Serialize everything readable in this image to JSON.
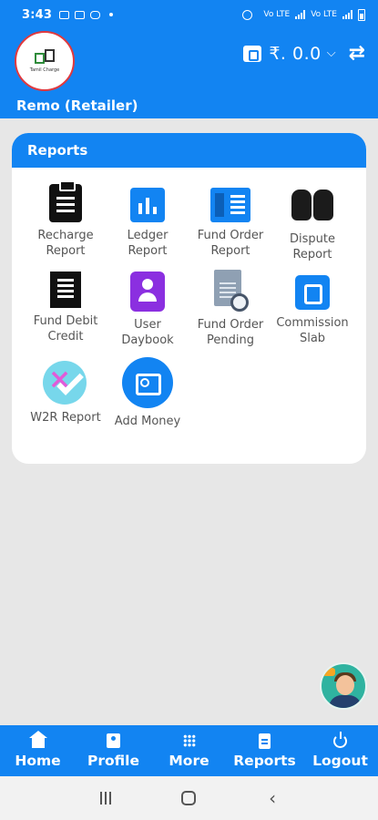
{
  "status_bar": {
    "time": "3:43",
    "icons": [
      "photo-icon",
      "app-icon",
      "chat-icon"
    ],
    "right_icons": [
      "alarm-icon",
      "vol-lte-icon",
      "signal-icon",
      "vol-lte2-icon",
      "signal2-icon",
      "battery-icon"
    ]
  },
  "header": {
    "logo_text": "Tamil Charge",
    "user_name": "Remo (Retailer)",
    "balance": "₹. 0.0",
    "accent_color": "#1284f2"
  },
  "reports_card": {
    "title": "Reports",
    "items": [
      {
        "label": "Recharge\nReport",
        "icon": "clipboard-icon"
      },
      {
        "label": "Ledger\nReport",
        "icon": "bar-chart-icon"
      },
      {
        "label": "Fund Order\nReport",
        "icon": "document-icon"
      },
      {
        "label": "Dispute\nReport",
        "icon": "dispute-icon"
      },
      {
        "label": "Fund Debit\nCredit",
        "icon": "receipt-icon"
      },
      {
        "label": "User\nDaybook",
        "icon": "user-book-icon"
      },
      {
        "label": "Fund Order\nPending",
        "icon": "pending-doc-icon"
      },
      {
        "label": "Commission\nSlab",
        "icon": "wallet-icon"
      },
      {
        "label": "W2R Report",
        "icon": "w2r-icon"
      },
      {
        "label": "Add Money",
        "icon": "add-money-icon"
      }
    ]
  },
  "bottom_nav": {
    "items": [
      {
        "label": "Home",
        "icon": "home-icon"
      },
      {
        "label": "Profile",
        "icon": "profile-icon"
      },
      {
        "label": "More",
        "icon": "grid-icon"
      },
      {
        "label": "Reports",
        "icon": "report-icon"
      },
      {
        "label": "Logout",
        "icon": "power-icon"
      }
    ]
  }
}
